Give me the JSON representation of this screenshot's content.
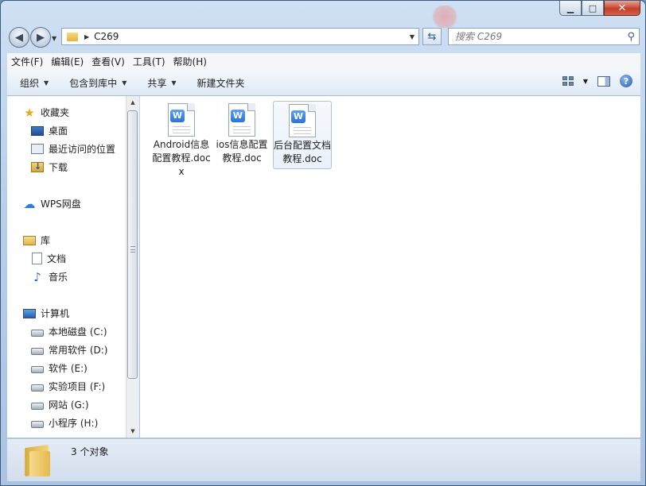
{
  "window": {
    "controls": {
      "minimize": "▁",
      "maximize": "□",
      "close": "✕"
    }
  },
  "nav": {
    "back": "◀",
    "forward": "▶",
    "path_arrow": "▶",
    "path": "C269",
    "search_placeholder": "搜索 C269"
  },
  "menu": [
    "文件(F)",
    "编辑(E)",
    "查看(V)",
    "工具(T)",
    "帮助(H)"
  ],
  "commands": [
    "组织",
    "包含到库中",
    "共享",
    "新建文件夹"
  ],
  "sidebar": {
    "favorites": {
      "label": "收藏夹",
      "items": [
        "桌面",
        "最近访问的位置",
        "下载"
      ]
    },
    "wps": "WPS网盘",
    "libraries": {
      "label": "库",
      "items": [
        "文档",
        "音乐"
      ]
    },
    "computer": {
      "label": "计算机",
      "drives": [
        "本地磁盘 (C:)",
        "常用软件 (D:)",
        "软件 (E:)",
        "实验项目 (F:)",
        "网站 (G:)",
        "小程序 (H:)"
      ]
    }
  },
  "files": [
    {
      "name": "Android信息配置教程.docx",
      "icon": "wps-writer-icon",
      "selected": false
    },
    {
      "name": "ios信息配置教程.doc",
      "icon": "wps-writer-icon",
      "selected": false
    },
    {
      "name": "后台配置文档教程.doc",
      "icon": "wps-writer-icon",
      "selected": true
    }
  ],
  "status": {
    "count": "3 个对象"
  },
  "colors": {
    "selection": "#eaf1fa",
    "accent": "#2d73d8"
  }
}
